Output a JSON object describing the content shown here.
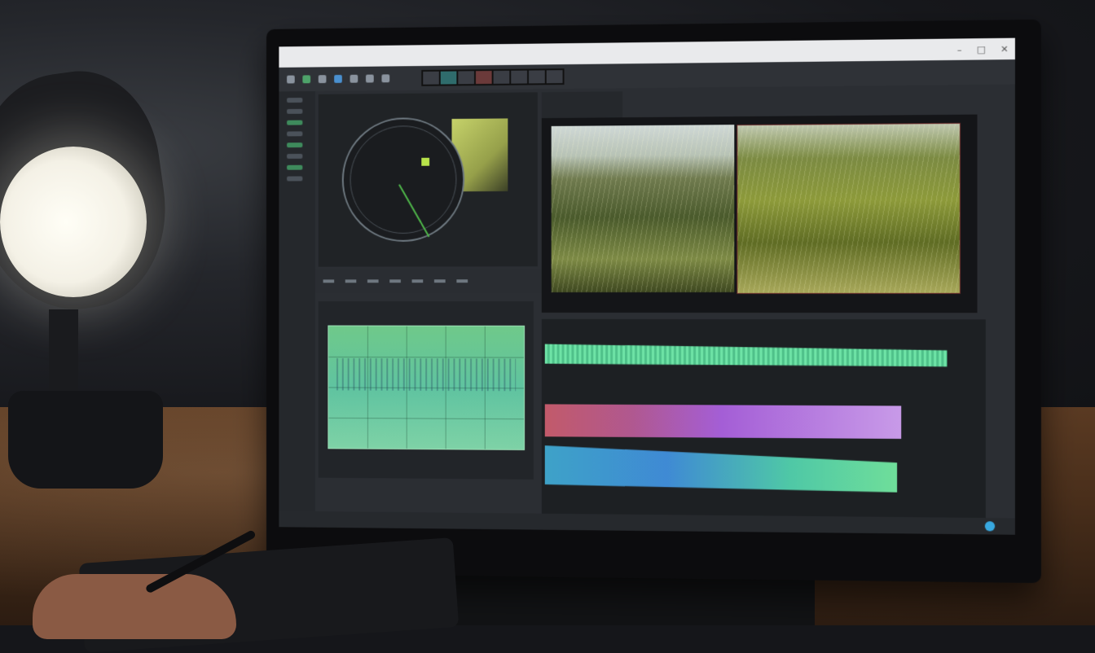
{
  "scene": {
    "description_colors": {
      "accent_green": "#6ee3a6",
      "accent_purple": "#a45ed6",
      "accent_blue": "#3f8ad4",
      "lamp_glow": "#fffef6"
    }
  },
  "monitor": {
    "brand_text": "—"
  },
  "icons": [
    "play-icon",
    "settings-icon",
    "record-icon",
    "close-icon"
  ]
}
